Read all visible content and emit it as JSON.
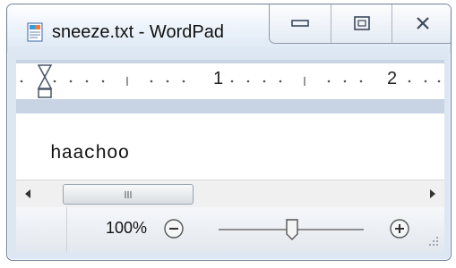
{
  "window": {
    "title": "sneeze.txt - WordPad",
    "caption_buttons": [
      "minimize-icon",
      "maximize-icon",
      "close-icon"
    ]
  },
  "ruler": {
    "numbers": [
      "1",
      "2"
    ]
  },
  "document": {
    "text": "haachoo"
  },
  "scrollbar": {
    "left_arrow": "arrow-left-icon",
    "right_arrow": "arrow-right-icon"
  },
  "status": {
    "zoom": "100%",
    "zoom_level": 1.0,
    "zoom_out_icon": "zoom-out-icon",
    "zoom_in_icon": "zoom-in-icon"
  },
  "colors": {
    "frame": "#dce7f3",
    "ruler_band": "#c8d3e3"
  }
}
